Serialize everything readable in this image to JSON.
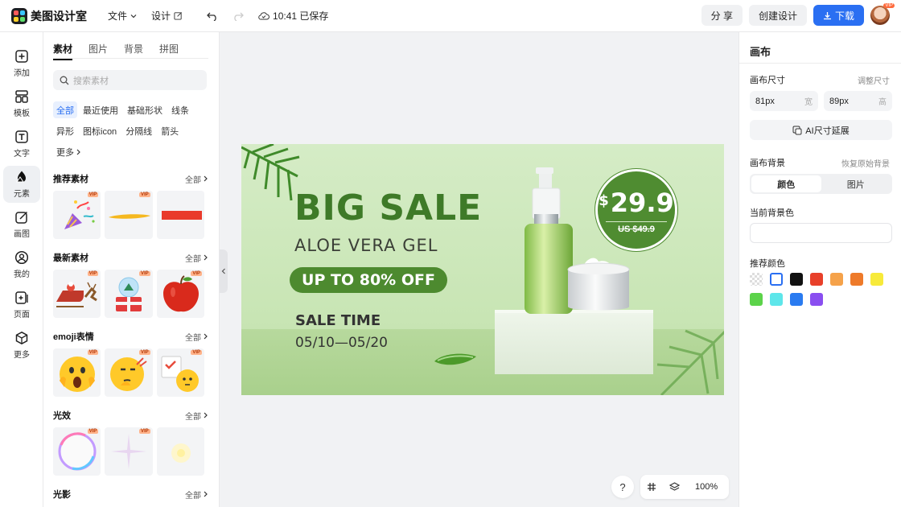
{
  "app": {
    "name": "美图设计室"
  },
  "topbar": {
    "file_label": "文件",
    "design_label": "设计",
    "saved_status": "10:41 已保存",
    "share_label": "分 享",
    "create_label": "创建设计",
    "download_label": "下载",
    "avatar_badge": "VIP"
  },
  "rail": {
    "items": [
      {
        "label": "添加",
        "icon": "plus-square-icon"
      },
      {
        "label": "模板",
        "icon": "template-icon"
      },
      {
        "label": "文字",
        "icon": "text-icon"
      },
      {
        "label": "元素",
        "icon": "shapes-icon"
      },
      {
        "label": "画图",
        "icon": "draw-icon"
      },
      {
        "label": "我的",
        "icon": "user-icon"
      },
      {
        "label": "页面",
        "icon": "page-icon"
      },
      {
        "label": "更多",
        "icon": "cube-icon"
      }
    ],
    "active_index": 3
  },
  "panel": {
    "tabs": [
      "素材",
      "图片",
      "背景",
      "拼图"
    ],
    "active_tab": 0,
    "search_placeholder": "搜索素材",
    "chips": [
      "全部",
      "最近使用",
      "基础形状",
      "线条",
      "异形",
      "图标icon",
      "分隔线",
      "箭头",
      "更多"
    ],
    "all_label": "全部",
    "vip_label": "VIP",
    "sections": [
      {
        "title": "推荐素材",
        "thumbs": [
          {
            "name": "party-popper-thumb",
            "vip": true
          },
          {
            "name": "yellow-stroke-thumb",
            "vip": true
          },
          {
            "name": "red-bar-thumb",
            "vip": false
          }
        ]
      },
      {
        "title": "最新素材",
        "thumbs": [
          {
            "name": "santa-sleigh-thumb",
            "vip": true
          },
          {
            "name": "snow-globe-gift-thumb",
            "vip": true
          },
          {
            "name": "red-apple-thumb",
            "vip": true
          }
        ]
      },
      {
        "title": "emoji表情",
        "thumbs": [
          {
            "name": "shocked-emoji-thumb",
            "vip": true
          },
          {
            "name": "thinking-emoji-thumb",
            "vip": true
          },
          {
            "name": "checklist-emoji-thumb",
            "vip": true
          }
        ]
      },
      {
        "title": "光效",
        "thumbs": [
          {
            "name": "rainbow-ring-thumb",
            "vip": true
          },
          {
            "name": "sparkle-star-thumb",
            "vip": true
          },
          {
            "name": "glow-dot-thumb",
            "vip": false
          }
        ]
      },
      {
        "title": "光影",
        "thumbs": []
      }
    ]
  },
  "canvas": {
    "headline": "BIG SALE",
    "product": "ALOE VERA GEL",
    "discount": "UP TO 80% OFF",
    "sale_time_label": "SALE TIME",
    "dates": "05/10—05/20",
    "price_currency": "$",
    "price": "29.9",
    "old_price": "US $49.9"
  },
  "bottombar": {
    "help": "?",
    "zoom": "100%"
  },
  "props": {
    "title": "画布",
    "size_label": "画布尺寸",
    "resize_link": "调整尺寸",
    "width_value": "81px",
    "width_unit": "宽",
    "height_value": "89px",
    "height_unit": "高",
    "ai_extend": "AI尺寸延展",
    "bg_label": "画布背景",
    "restore_link": "恢复原始背景",
    "seg_color": "颜色",
    "seg_image": "图片",
    "current_bg_label": "当前背景色",
    "recommend_label": "推荐颜色",
    "swatches": [
      "transparent",
      "#ffffff",
      "#111111",
      "#e8402a",
      "#f5a24a",
      "#ee7a2a",
      "#f7ea3a",
      "#5cd34a",
      "#5ee6ea",
      "#2a7bf0",
      "#8a4ef0"
    ]
  }
}
